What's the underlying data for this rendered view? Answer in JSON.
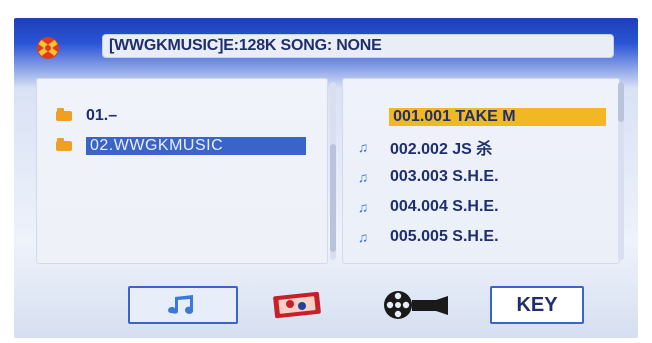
{
  "status_bar": {
    "text": "[WWGKMUSIC]E:128K SONG: NONE",
    "icon": "disc-icon"
  },
  "folders": [
    {
      "label": "01.–",
      "icon": "folder-icon",
      "selected": false
    },
    {
      "label": "02.WWGKMUSIC",
      "icon": "folder-icon",
      "selected": true
    }
  ],
  "songs": [
    {
      "label": "001.001 TAKE M",
      "icon": "music-note-icon",
      "selected": true
    },
    {
      "label": "002.002 JS 杀",
      "icon": "music-note-icon",
      "selected": false
    },
    {
      "label": "003.003 S.H.E.",
      "icon": "music-note-icon",
      "selected": false
    },
    {
      "label": "004.004 S.H.E.",
      "icon": "music-note-icon",
      "selected": false
    },
    {
      "label": "005.005 S.H.E.",
      "icon": "music-note-icon",
      "selected": false
    }
  ],
  "toolbar": {
    "music_icon": "music-note-icon",
    "photo_icon": "photo-icon",
    "movie_icon": "film-reel-icon",
    "key_label": "KEY"
  },
  "colors": {
    "screen_top": "#1d3fb8",
    "text": "#1f2e6e",
    "folder_selected_bg": "#3a64c8",
    "song_selected_bg": "#f2b823",
    "note_icon": "#3c78d8",
    "folder_icon": "#f0a020"
  }
}
